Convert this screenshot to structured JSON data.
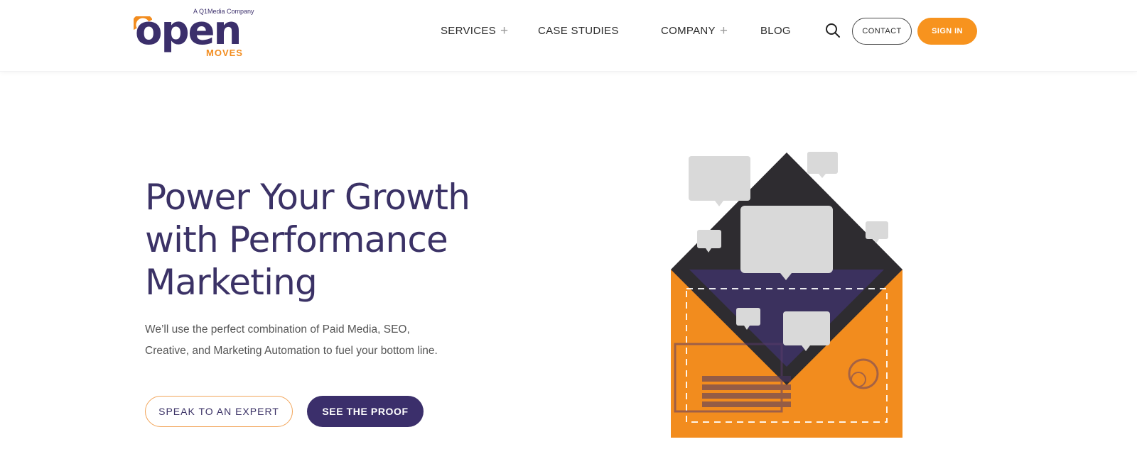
{
  "brand": {
    "tagline": "A Q1Media Company",
    "wordmark": "open",
    "submark": "MOVES",
    "primary_color": "#3b2f6b",
    "accent_color": "#f7931e"
  },
  "nav": {
    "items": [
      {
        "label": "SERVICES",
        "has_submenu": true,
        "icon": "plus-icon"
      },
      {
        "label": "CASE STUDIES",
        "has_submenu": false
      },
      {
        "label": "COMPANY",
        "has_submenu": true,
        "icon": "plus-icon"
      },
      {
        "label": "BLOG",
        "has_submenu": false
      }
    ],
    "plus_symbol": "+",
    "search_icon": "search-icon",
    "contact_label": "CONTACT",
    "signin_label": "SIGN IN"
  },
  "hero": {
    "title_lines": [
      "Power Your Growth",
      "with Performance",
      "Marketing"
    ],
    "subtitle_lines": [
      "We’ll use the perfect combination of Paid Media, SEO,",
      "Creative, and Marketing Automation to fuel your bottom line."
    ],
    "cta_secondary": "SPEAK TO AN EXPERT",
    "cta_primary": "SEE THE PROOF"
  },
  "illustration": {
    "subject": "envelope-with-chat-bubbles",
    "colors": {
      "flap": "#2e2c30",
      "body": "#f28c1e",
      "inner": "#3d3366",
      "bubble": "#d9d9d9"
    }
  }
}
